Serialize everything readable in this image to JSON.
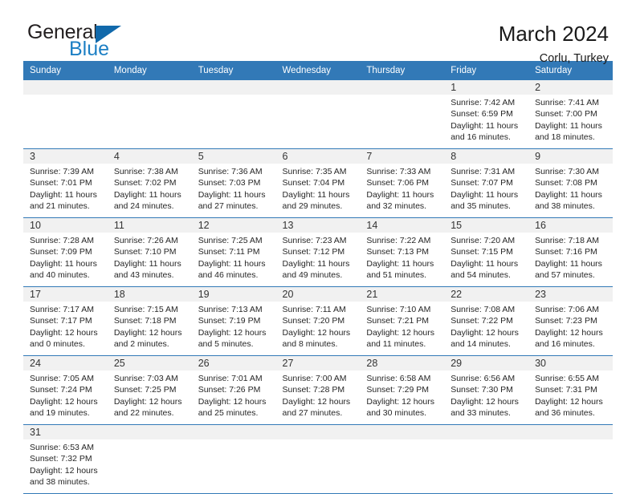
{
  "brand": {
    "name_part1": "General",
    "name_part2": "Blue",
    "triangle_color": "#1169ab",
    "blue_text_color": "#1c7fc4"
  },
  "header": {
    "title": "March 2024",
    "location": "Corlu, Turkey"
  },
  "theme": {
    "header_blue": "#3279b7",
    "daynum_band": "#f1f1f1",
    "text": "#262626"
  },
  "weekday_headers": [
    "Sunday",
    "Monday",
    "Tuesday",
    "Wednesday",
    "Thursday",
    "Friday",
    "Saturday"
  ],
  "weeks": [
    {
      "days": [
        {
          "num": "",
          "lines": []
        },
        {
          "num": "",
          "lines": []
        },
        {
          "num": "",
          "lines": []
        },
        {
          "num": "",
          "lines": []
        },
        {
          "num": "",
          "lines": []
        },
        {
          "num": "1",
          "lines": [
            "Sunrise: 7:42 AM",
            "Sunset: 6:59 PM",
            "Daylight: 11 hours",
            "and 16 minutes."
          ]
        },
        {
          "num": "2",
          "lines": [
            "Sunrise: 7:41 AM",
            "Sunset: 7:00 PM",
            "Daylight: 11 hours",
            "and 18 minutes."
          ]
        }
      ]
    },
    {
      "days": [
        {
          "num": "3",
          "lines": [
            "Sunrise: 7:39 AM",
            "Sunset: 7:01 PM",
            "Daylight: 11 hours",
            "and 21 minutes."
          ]
        },
        {
          "num": "4",
          "lines": [
            "Sunrise: 7:38 AM",
            "Sunset: 7:02 PM",
            "Daylight: 11 hours",
            "and 24 minutes."
          ]
        },
        {
          "num": "5",
          "lines": [
            "Sunrise: 7:36 AM",
            "Sunset: 7:03 PM",
            "Daylight: 11 hours",
            "and 27 minutes."
          ]
        },
        {
          "num": "6",
          "lines": [
            "Sunrise: 7:35 AM",
            "Sunset: 7:04 PM",
            "Daylight: 11 hours",
            "and 29 minutes."
          ]
        },
        {
          "num": "7",
          "lines": [
            "Sunrise: 7:33 AM",
            "Sunset: 7:06 PM",
            "Daylight: 11 hours",
            "and 32 minutes."
          ]
        },
        {
          "num": "8",
          "lines": [
            "Sunrise: 7:31 AM",
            "Sunset: 7:07 PM",
            "Daylight: 11 hours",
            "and 35 minutes."
          ]
        },
        {
          "num": "9",
          "lines": [
            "Sunrise: 7:30 AM",
            "Sunset: 7:08 PM",
            "Daylight: 11 hours",
            "and 38 minutes."
          ]
        }
      ]
    },
    {
      "days": [
        {
          "num": "10",
          "lines": [
            "Sunrise: 7:28 AM",
            "Sunset: 7:09 PM",
            "Daylight: 11 hours",
            "and 40 minutes."
          ]
        },
        {
          "num": "11",
          "lines": [
            "Sunrise: 7:26 AM",
            "Sunset: 7:10 PM",
            "Daylight: 11 hours",
            "and 43 minutes."
          ]
        },
        {
          "num": "12",
          "lines": [
            "Sunrise: 7:25 AM",
            "Sunset: 7:11 PM",
            "Daylight: 11 hours",
            "and 46 minutes."
          ]
        },
        {
          "num": "13",
          "lines": [
            "Sunrise: 7:23 AM",
            "Sunset: 7:12 PM",
            "Daylight: 11 hours",
            "and 49 minutes."
          ]
        },
        {
          "num": "14",
          "lines": [
            "Sunrise: 7:22 AM",
            "Sunset: 7:13 PM",
            "Daylight: 11 hours",
            "and 51 minutes."
          ]
        },
        {
          "num": "15",
          "lines": [
            "Sunrise: 7:20 AM",
            "Sunset: 7:15 PM",
            "Daylight: 11 hours",
            "and 54 minutes."
          ]
        },
        {
          "num": "16",
          "lines": [
            "Sunrise: 7:18 AM",
            "Sunset: 7:16 PM",
            "Daylight: 11 hours",
            "and 57 minutes."
          ]
        }
      ]
    },
    {
      "days": [
        {
          "num": "17",
          "lines": [
            "Sunrise: 7:17 AM",
            "Sunset: 7:17 PM",
            "Daylight: 12 hours",
            "and 0 minutes."
          ]
        },
        {
          "num": "18",
          "lines": [
            "Sunrise: 7:15 AM",
            "Sunset: 7:18 PM",
            "Daylight: 12 hours",
            "and 2 minutes."
          ]
        },
        {
          "num": "19",
          "lines": [
            "Sunrise: 7:13 AM",
            "Sunset: 7:19 PM",
            "Daylight: 12 hours",
            "and 5 minutes."
          ]
        },
        {
          "num": "20",
          "lines": [
            "Sunrise: 7:11 AM",
            "Sunset: 7:20 PM",
            "Daylight: 12 hours",
            "and 8 minutes."
          ]
        },
        {
          "num": "21",
          "lines": [
            "Sunrise: 7:10 AM",
            "Sunset: 7:21 PM",
            "Daylight: 12 hours",
            "and 11 minutes."
          ]
        },
        {
          "num": "22",
          "lines": [
            "Sunrise: 7:08 AM",
            "Sunset: 7:22 PM",
            "Daylight: 12 hours",
            "and 14 minutes."
          ]
        },
        {
          "num": "23",
          "lines": [
            "Sunrise: 7:06 AM",
            "Sunset: 7:23 PM",
            "Daylight: 12 hours",
            "and 16 minutes."
          ]
        }
      ]
    },
    {
      "days": [
        {
          "num": "24",
          "lines": [
            "Sunrise: 7:05 AM",
            "Sunset: 7:24 PM",
            "Daylight: 12 hours",
            "and 19 minutes."
          ]
        },
        {
          "num": "25",
          "lines": [
            "Sunrise: 7:03 AM",
            "Sunset: 7:25 PM",
            "Daylight: 12 hours",
            "and 22 minutes."
          ]
        },
        {
          "num": "26",
          "lines": [
            "Sunrise: 7:01 AM",
            "Sunset: 7:26 PM",
            "Daylight: 12 hours",
            "and 25 minutes."
          ]
        },
        {
          "num": "27",
          "lines": [
            "Sunrise: 7:00 AM",
            "Sunset: 7:28 PM",
            "Daylight: 12 hours",
            "and 27 minutes."
          ]
        },
        {
          "num": "28",
          "lines": [
            "Sunrise: 6:58 AM",
            "Sunset: 7:29 PM",
            "Daylight: 12 hours",
            "and 30 minutes."
          ]
        },
        {
          "num": "29",
          "lines": [
            "Sunrise: 6:56 AM",
            "Sunset: 7:30 PM",
            "Daylight: 12 hours",
            "and 33 minutes."
          ]
        },
        {
          "num": "30",
          "lines": [
            "Sunrise: 6:55 AM",
            "Sunset: 7:31 PM",
            "Daylight: 12 hours",
            "and 36 minutes."
          ]
        }
      ]
    },
    {
      "days": [
        {
          "num": "31",
          "lines": [
            "Sunrise: 6:53 AM",
            "Sunset: 7:32 PM",
            "Daylight: 12 hours",
            "and 38 minutes."
          ]
        },
        {
          "num": "",
          "lines": []
        },
        {
          "num": "",
          "lines": []
        },
        {
          "num": "",
          "lines": []
        },
        {
          "num": "",
          "lines": []
        },
        {
          "num": "",
          "lines": []
        },
        {
          "num": "",
          "lines": []
        }
      ]
    }
  ]
}
